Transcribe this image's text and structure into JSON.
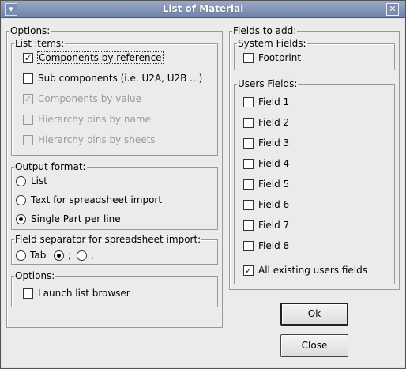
{
  "window": {
    "title": "List of Material"
  },
  "icons": {
    "system": "window-menu-icon",
    "close": "close-icon",
    "check": "checkmark"
  },
  "options": {
    "legend": "Options:",
    "list_items": {
      "legend": "List items:",
      "items": [
        {
          "label": "Components by reference",
          "checked": true,
          "enabled": true
        },
        {
          "label": "Sub components (i.e. U2A, U2B ...)",
          "checked": false,
          "enabled": true
        },
        {
          "label": "Components by value",
          "checked": true,
          "enabled": false
        },
        {
          "label": "Hierarchy pins by name",
          "checked": false,
          "enabled": false
        },
        {
          "label": "Hierarchy pins by sheets",
          "checked": false,
          "enabled": false
        }
      ]
    },
    "output_format": {
      "legend": "Output format:",
      "options": [
        "List",
        "Text for spreadsheet import",
        "Single Part per line"
      ],
      "selected": "Single Part per line"
    },
    "field_separator": {
      "legend": "Field separator for spreadsheet import:",
      "options": [
        "Tab",
        ";",
        ","
      ],
      "selected": ";"
    },
    "options2": {
      "legend": "Options:",
      "launch_list_browser": {
        "label": "Launch list browser",
        "checked": false
      }
    }
  },
  "fields_to_add": {
    "legend": "Fields to add:",
    "system_fields": {
      "legend": "System Fields:",
      "footprint": {
        "label": "Footprint",
        "checked": false
      }
    },
    "users_fields": {
      "legend": "Users Fields:",
      "items": [
        {
          "label": "Field 1",
          "checked": false
        },
        {
          "label": "Field 2",
          "checked": false
        },
        {
          "label": "Field 3",
          "checked": false
        },
        {
          "label": "Field 4",
          "checked": false
        },
        {
          "label": "Field 5",
          "checked": false
        },
        {
          "label": "Field 6",
          "checked": false
        },
        {
          "label": "Field 7",
          "checked": false
        },
        {
          "label": "Field 8",
          "checked": false
        },
        {
          "label": "All existing users fields",
          "checked": true
        }
      ]
    }
  },
  "buttons": {
    "ok": "Ok",
    "close": "Close"
  }
}
